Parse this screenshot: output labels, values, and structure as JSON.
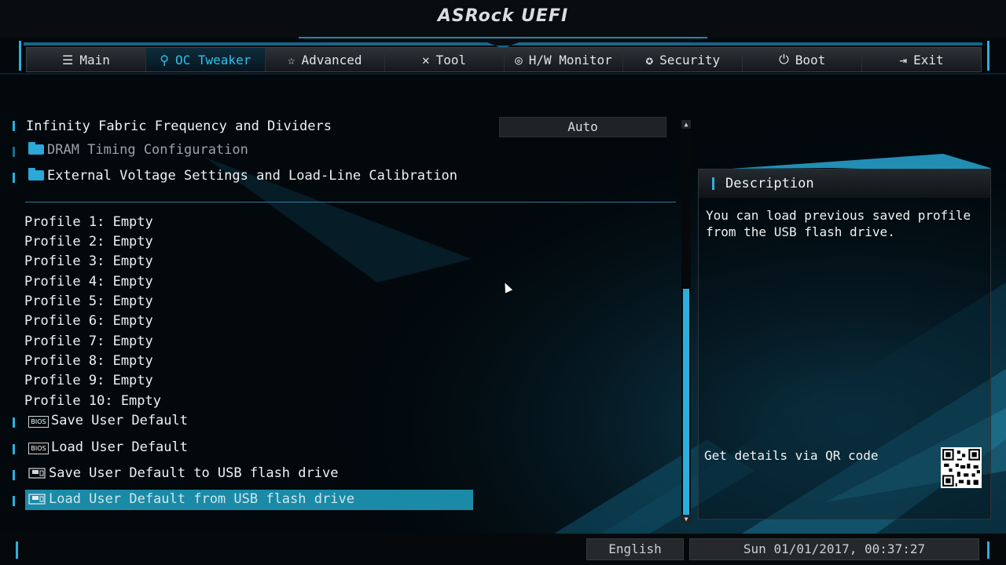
{
  "header": {
    "brand": "ASRock UEFI"
  },
  "nav": {
    "tabs": [
      {
        "label": "Main",
        "icon": "list-icon",
        "active": false
      },
      {
        "label": "OC Tweaker",
        "icon": "rocket-icon",
        "active": true
      },
      {
        "label": "Advanced",
        "icon": "star-icon",
        "active": false
      },
      {
        "label": "Tool",
        "icon": "tools-icon",
        "active": false
      },
      {
        "label": "H/W Monitor",
        "icon": "monitor-icon",
        "active": false
      },
      {
        "label": "Security",
        "icon": "shield-icon",
        "active": false
      },
      {
        "label": "Boot",
        "icon": "power-icon",
        "active": false
      },
      {
        "label": "Exit",
        "icon": "exit-icon",
        "active": false
      }
    ]
  },
  "settings": {
    "infinity_fabric": {
      "label": "Infinity Fabric Frequency and Dividers",
      "value": "Auto"
    },
    "dram_timing": "DRAM Timing Configuration",
    "external_voltage": "External Voltage Settings and Load-Line Calibration",
    "profiles": [
      "Profile 1: Empty",
      "Profile 2: Empty",
      "Profile 3: Empty",
      "Profile 4: Empty",
      "Profile 5: Empty",
      "Profile 6: Empty",
      "Profile 7: Empty",
      "Profile 8: Empty",
      "Profile 9: Empty",
      "Profile 10: Empty"
    ],
    "save_user_default": "Save User Default",
    "load_user_default": "Load User Default",
    "save_usb": "Save User Default to USB flash drive",
    "load_usb": "Load User Default from USB flash drive",
    "bios_badge": "BIOS"
  },
  "description": {
    "title": "Description",
    "text": "You can load previous saved profile from the USB flash drive.",
    "qr_label": "Get details via QR code"
  },
  "footer": {
    "language": "English",
    "datetime": "Sun 01/01/2017, 00:37:27"
  },
  "colors": {
    "accent": "#2ab0de",
    "selection": "#1a8aa6",
    "background": "#02080c"
  }
}
